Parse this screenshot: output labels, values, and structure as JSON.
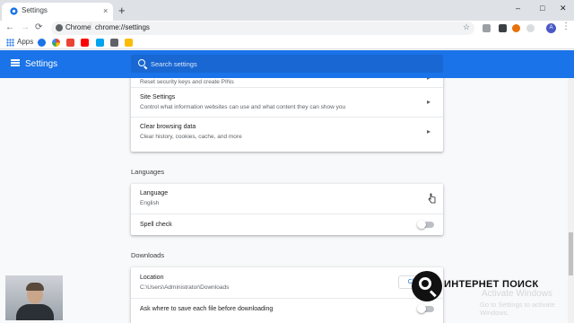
{
  "tab": {
    "title": "Settings",
    "close": "×",
    "new_tab": "+"
  },
  "window_controls": {
    "minimize": "–",
    "maximize": "□",
    "close": "✕"
  },
  "toolbar": {
    "back": "←",
    "forward": "→",
    "reload": "⟳",
    "host": "Chrome",
    "separator": "|",
    "url": "chrome://settings",
    "star": "☆",
    "avatar": "A",
    "menu": "⋮"
  },
  "bookmarks": {
    "apps_label": "Apps"
  },
  "header": {
    "title": "Settings",
    "search_placeholder": "Search settings"
  },
  "privacy_card": {
    "security_keys_sub": "Reset security keys and create PINs",
    "site_settings": {
      "title": "Site Settings",
      "sub": "Control what information websites can use and what content they can show you"
    },
    "clear_browsing": {
      "title": "Clear browsing data",
      "sub": "Clear history, cookies, cache, and more"
    },
    "arrow": "▸"
  },
  "languages": {
    "section_title": "Languages",
    "language": {
      "title": "Language",
      "value": "English"
    },
    "spell_check": {
      "title": "Spell check",
      "enabled": false
    }
  },
  "downloads": {
    "section_title": "Downloads",
    "location": {
      "title": "Location",
      "value": "C:\\Users\\Administrator\\Downloads",
      "button": "Change"
    },
    "ask_where": {
      "title": "Ask where to save each file before downloading",
      "enabled": false
    }
  },
  "overlay": {
    "activate_title": "Activate Windows",
    "activate_sub": "Go to Settings to activate Windows.",
    "brand": "ИНТЕРНЕТ ПОИСК"
  },
  "colors": {
    "accent": "#1a73e8",
    "header_search": "#1967d2"
  }
}
